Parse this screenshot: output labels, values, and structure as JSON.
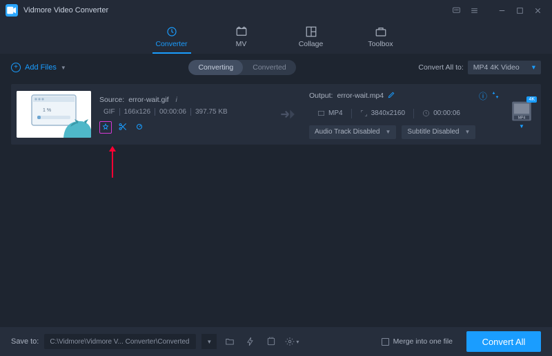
{
  "app_title": "Vidmore Video Converter",
  "tabs": {
    "converter": "Converter",
    "mv": "MV",
    "collage": "Collage",
    "toolbox": "Toolbox"
  },
  "toolbar": {
    "add_files": "Add Files",
    "converting": "Converting",
    "converted": "Converted",
    "convert_all_to": "Convert All to:",
    "format": "MP4 4K Video"
  },
  "item": {
    "source_label": "Source:",
    "source_name": "error-wait.gif",
    "format": "GIF",
    "dimensions": "166x126",
    "duration": "00:00:06",
    "size": "397.75 KB",
    "output_label": "Output:",
    "output_name": "error-wait.mp4",
    "out_format": "MP4",
    "out_res": "3840x2160",
    "out_dur": "00:00:06",
    "audio": "Audio Track Disabled",
    "subtitle": "Subtitle Disabled",
    "badge": "4K",
    "file_badge": "MP4"
  },
  "footer": {
    "save_to_label": "Save to:",
    "path": "C:\\Vidmore\\Vidmore V... Converter\\Converted",
    "merge": "Merge into one file",
    "convert_all": "Convert All"
  }
}
